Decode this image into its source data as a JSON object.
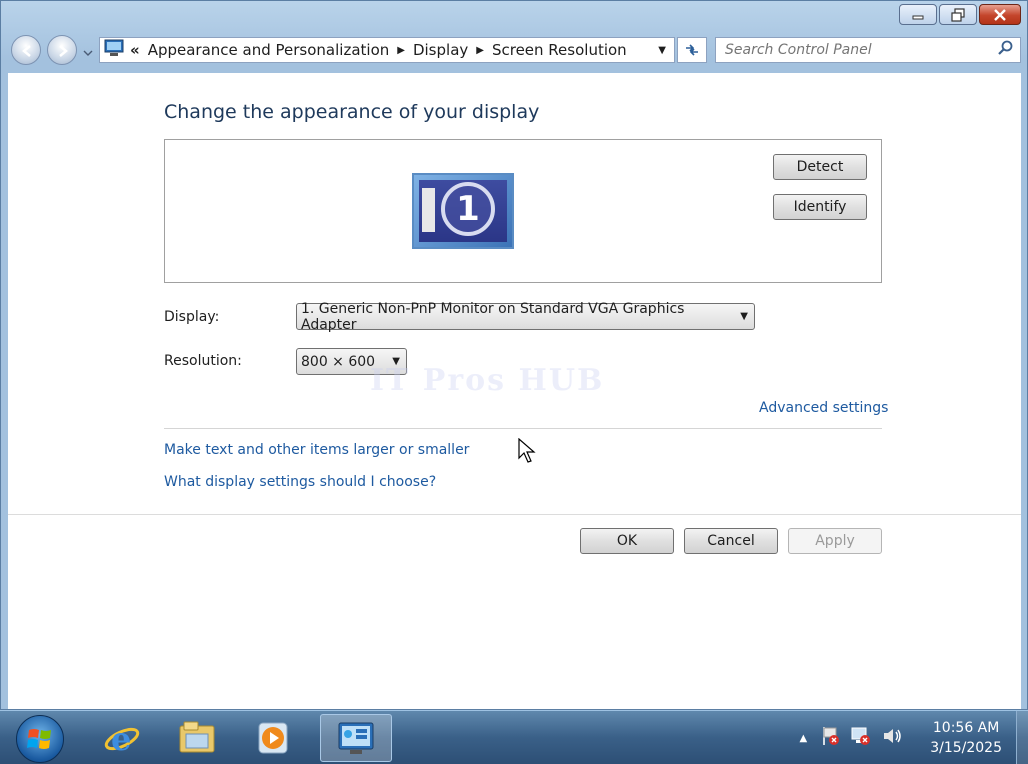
{
  "address": {
    "overflow": "«",
    "crumbs": [
      "Appearance and Personalization",
      "Display",
      "Screen Resolution"
    ]
  },
  "search": {
    "placeholder": "Search Control Panel"
  },
  "main": {
    "heading": "Change the appearance of your display",
    "monitor_number": "1",
    "detect_label": "Detect",
    "identify_label": "Identify",
    "display_label": "Display:",
    "display_value": "1. Generic Non-PnP Monitor on Standard VGA Graphics Adapter",
    "resolution_label": "Resolution:",
    "resolution_value": "800 × 600",
    "advanced_link": "Advanced settings",
    "text_size_link": "Make text and other items larger or smaller",
    "help_link": "What display settings should I choose?",
    "ok_label": "OK",
    "cancel_label": "Cancel",
    "apply_label": "Apply"
  },
  "watermark": "IT Pros HUB",
  "taskbar": {
    "time": "10:56 AM",
    "date": "3/15/2025",
    "pinned": [
      "internet-explorer-icon",
      "windows-explorer-icon",
      "media-player-icon",
      "control-panel-icon"
    ]
  },
  "colors": {
    "link": "#1e5aa0",
    "heading": "#1e395b",
    "taskbar": "#3a6088",
    "close_button": "#c4452c"
  }
}
